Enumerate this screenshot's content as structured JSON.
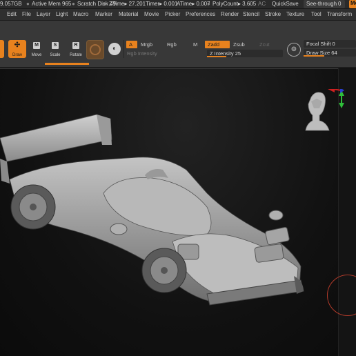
{
  "status_bar": {
    "mem": "9.057GB",
    "active_mem": "Active Mem 965",
    "scratch_disk": "Scratch Disk 49",
    "ztime": "ZTime▸ 27.201",
    "timer": "Timer▸ 0.001",
    "atime": "ATime▸ 0.007",
    "polycount": "PolyCount▸ 3.605",
    "ac": "AC",
    "quicksave": "QuickSave",
    "see_through": "See-through",
    "see_through_value": "0",
    "menus_tab": "Me"
  },
  "menu_bar": {
    "items": [
      "Edit",
      "File",
      "Layer",
      "Light",
      "Macro",
      "Marker",
      "Material",
      "Movie",
      "Picker",
      "Preferences",
      "Render",
      "Stencil",
      "Stroke",
      "Texture",
      "Tool",
      "Transform"
    ]
  },
  "shelf": {
    "tools": [
      {
        "label": "Draw",
        "icon": "draw-icon"
      },
      {
        "label": "Move",
        "icon": "move-icon"
      },
      {
        "label": "Scale",
        "icon": "scale-icon"
      },
      {
        "label": "Rotate",
        "icon": "rotate-icon"
      }
    ],
    "a_label": "A",
    "mrgb_label": "Mrgb",
    "rgb_label": "Rgb",
    "m_label": "M",
    "rgb_intensity_label": "Rgb Intensity",
    "zadd_label": "Zadd",
    "zsub_label": "Zsub",
    "zcut_label": "Zcut",
    "z_intensity_label": "Z Intensity",
    "z_intensity_value": "25",
    "focal_shift_label": "Focal Shift",
    "focal_shift_value": "0",
    "draw_size_label": "Draw Size",
    "draw_size_value": "64"
  },
  "colors": {
    "accent": "#e8821e",
    "panel": "#383838",
    "canvas": "#111111"
  },
  "viewport": {
    "model": "race-car-mesh",
    "navigator": "head-orientation-gizmo"
  }
}
